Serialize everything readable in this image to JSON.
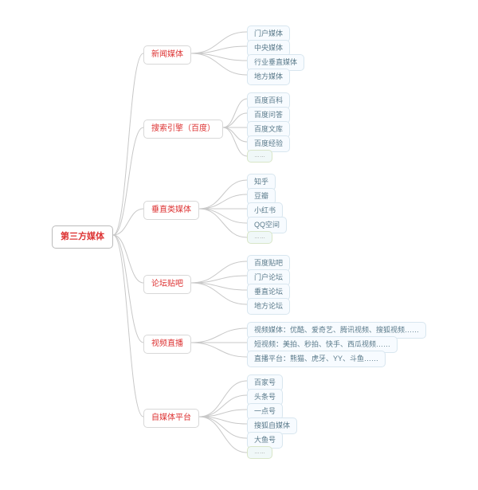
{
  "mindmap": {
    "root": "第三方媒体",
    "branches": [
      {
        "label": "新闻媒体",
        "children": [
          "门户媒体",
          "中央媒体",
          "行业垂直媒体",
          "地方媒体"
        ]
      },
      {
        "label": "搜索引擎（百度）",
        "children": [
          "百度百科",
          "百度问答",
          "百度文库",
          "百度经验",
          "……"
        ]
      },
      {
        "label": "垂直类媒体",
        "children": [
          "知乎",
          "豆瓣",
          "小红书",
          "QQ空间",
          "……"
        ]
      },
      {
        "label": "论坛贴吧",
        "children": [
          "百度贴吧",
          "门户论坛",
          "垂直论坛",
          "地方论坛"
        ]
      },
      {
        "label": "视频直播",
        "children": [
          "视频媒体：优酷、爱奇艺、腾讯视频、搜狐视频……",
          "短视频：美拍、秒拍、快手、西瓜视频……",
          "直播平台：熊猫、虎牙、YY、斗鱼……"
        ]
      },
      {
        "label": "自媒体平台",
        "children": [
          "百家号",
          "头条号",
          "一点号",
          "搜狐自媒体",
          "大鱼号",
          "……"
        ]
      }
    ]
  }
}
